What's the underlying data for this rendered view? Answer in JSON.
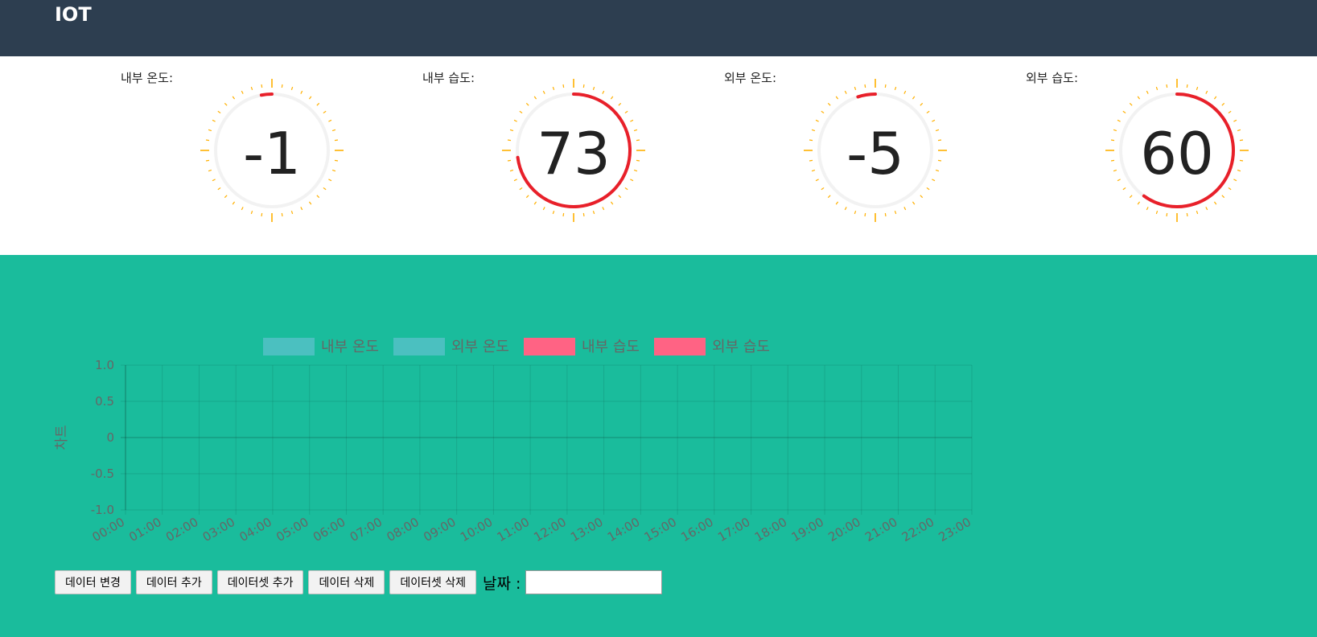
{
  "header": {
    "title": "IOT",
    "color": "#2d3e50"
  },
  "gauges": [
    {
      "label": "내부 온도:",
      "value": "-1",
      "level": -0.01
    },
    {
      "label": "내부 습도:",
      "value": "73",
      "level": 0.73
    },
    {
      "label": "외부 온도:",
      "value": "-5",
      "level": -0.05
    },
    {
      "label": "외부 습도:",
      "value": "60",
      "level": 0.6
    }
  ],
  "gauge_colors": {
    "ring": "#e8202a",
    "track": "#f2f2f2",
    "ticks": "#ffb000"
  },
  "chart_data": {
    "type": "bar",
    "categories": [
      "00:00",
      "01:00",
      "02:00",
      "03:00",
      "04:00",
      "05:00",
      "06:00",
      "07:00",
      "08:00",
      "09:00",
      "10:00",
      "11:00",
      "12:00",
      "13:00",
      "14:00",
      "15:00",
      "16:00",
      "17:00",
      "18:00",
      "19:00",
      "20:00",
      "21:00",
      "22:00",
      "23:00"
    ],
    "series": [
      {
        "name": "내부 온도",
        "color": "#4bc0c0",
        "values": []
      },
      {
        "name": "외부 온도",
        "color": "#4bc0c0",
        "values": []
      },
      {
        "name": "내부 습도",
        "color": "#ff6384",
        "values": []
      },
      {
        "name": "외부 습도",
        "color": "#ff6384",
        "values": []
      }
    ],
    "ylabel": "차트",
    "ylim": [
      -1.0,
      1.0
    ],
    "yticks": [
      "1.0",
      "0.5",
      "0",
      "-0.5",
      "-1.0"
    ],
    "grid": true,
    "legend": "top"
  },
  "controls": {
    "buttons": [
      "데이터 변경",
      "데이터 추가",
      "데이터셋 추가",
      "데이터 삭제",
      "데이터셋 삭제"
    ],
    "date_label": "날짜 :",
    "date_value": ""
  },
  "page": {
    "background": "#1abc9c"
  }
}
